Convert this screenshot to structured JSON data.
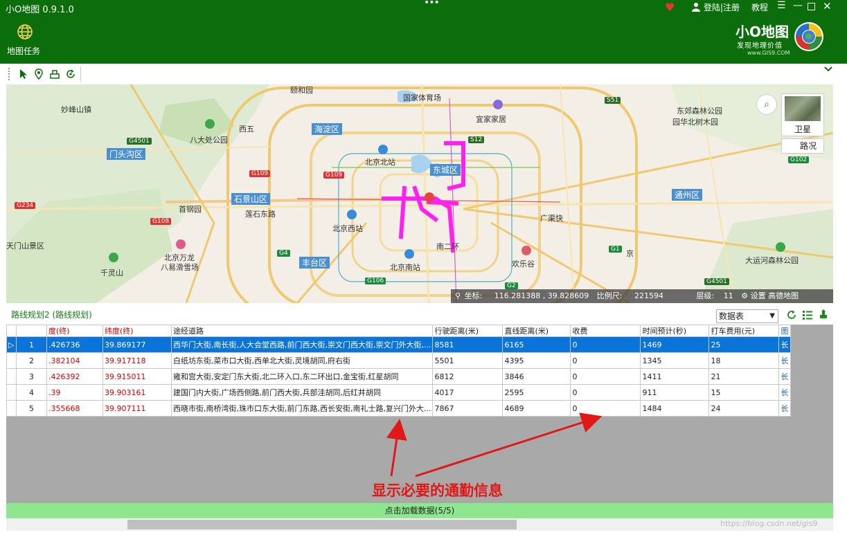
{
  "app": {
    "title": "小O地图 0.9.1.0",
    "login": "登陆|注册",
    "tutorial": "教程"
  },
  "sidebar": {
    "task_label": "地图任务"
  },
  "brand": {
    "name": "小O地图",
    "slogan": "发现地理价值",
    "url": "www.GIS9.COM"
  },
  "map": {
    "satellite_label": "卫星",
    "traffic_label": "路况",
    "coords_label": "坐标:",
    "lng": "116.281388",
    "lat": "39.828609",
    "scale_label": "比例尺:",
    "scale": "221594",
    "level_label": "层级:",
    "level": "11",
    "settings_label": "设置",
    "provider": "高德地图",
    "labels": {
      "yiheyuan": "颐和园",
      "guojia_tiyuchang": "国家体育场",
      "yijia": "宜家家居",
      "chaoyang_park": "东郊森林公园",
      "huabeishu": "园华北树木园",
      "miaofeng": "妙峰山镇",
      "badachu": "八大处公园",
      "xiwu": "西五",
      "yuquan": "石景山区",
      "lianshi": "莲石东路",
      "shougang": "首钢园",
      "bjbeizhan": "北京北站",
      "bjxizhan": "北京西站",
      "bjnanzhan": "北京南站",
      "guangqukuai": "广渠快",
      "nanerhuan": "南二环",
      "huanlegu": "欢乐谷",
      "bjwanlong": "北京万龙",
      "bajiao": "八易滑雪场",
      "qianling": "千灵山",
      "tianmen": "天门山景区",
      "dayunhe": "大运河森林公园",
      "jing": "京"
    },
    "districts": {
      "haidian": "海淀区",
      "mentougou": "门头沟区",
      "dongcheng": "东城区",
      "shijingshan": "石景山区",
      "fengtai": "丰台区",
      "tongzhou": "通州区"
    },
    "shields": {
      "g4501a": "G4501",
      "g109a": "G109",
      "g109b": "G109",
      "s12": "S12",
      "s51": "S51",
      "g102": "G102",
      "g234": "G234",
      "g108": "G108",
      "g4": "G4",
      "g1": "G1",
      "g106": "G106",
      "g2": "G2",
      "g4501b": "G4501"
    }
  },
  "panel": {
    "title": "路线规划2 (路线规划)",
    "dataset": "数据表",
    "load_more": "点击加载数据(5/5)"
  },
  "table": {
    "headers": [
      "",
      "度(终)",
      "纬度(终)",
      "途经道路",
      "行驶距离(米)",
      "直线距离(米)",
      "收费",
      "时间预计(秒)",
      "打车费用(元)",
      "图"
    ],
    "rows": [
      {
        "idx": "1",
        "lng": ".426736",
        "lat": "39.869177",
        "roads": "西华门大街,南长街,人大会堂西路,前门西大街,崇文门西大街,崇文门外大街,...",
        "drive": "8581",
        "straight": "6165",
        "toll": "0",
        "time": "1469",
        "taxi": "25",
        "link": "长"
      },
      {
        "idx": "2",
        "lng": ".382104",
        "lat": "39.917118",
        "roads": "白纸坊东街,菜市口大街,西单北大街,灵境胡同,府右街",
        "drive": "5501",
        "straight": "4395",
        "toll": "0",
        "time": "1345",
        "taxi": "18",
        "link": "长"
      },
      {
        "idx": "3",
        "lng": ".426392",
        "lat": "39.915011",
        "roads": "雍和宫大街,安定门东大街,北二环入口,东二环出口,金宝街,红星胡同",
        "drive": "6812",
        "straight": "3846",
        "toll": "0",
        "time": "1411",
        "taxi": "21",
        "link": "长"
      },
      {
        "idx": "4",
        "lng": ".39",
        "lat": "39.903161",
        "roads": "建国门内大街,广场西侧路,前门西大街,兵部洼胡同,后红井胡同",
        "drive": "4017",
        "straight": "2595",
        "toll": "0",
        "time": "911",
        "taxi": "15",
        "link": "长"
      },
      {
        "idx": "5",
        "lng": ".355668",
        "lat": "39.907111",
        "roads": "西晓市街,南桥湾街,珠市口东大街,前门东路,西长安街,南礼士路,复兴门外大...",
        "drive": "7867",
        "straight": "4689",
        "toll": "0",
        "time": "1484",
        "taxi": "24",
        "link": "长"
      }
    ]
  },
  "annotation": {
    "text": "显示必要的通勤信息"
  },
  "watermark": "https://blog.csdn.net/gis9",
  "colors": {
    "titlebar": "#0b6e0b",
    "route": "#ff22ee",
    "selected_row": "#0a74d8",
    "load_bar": "#8ee68e",
    "annotation": "#e01818"
  }
}
